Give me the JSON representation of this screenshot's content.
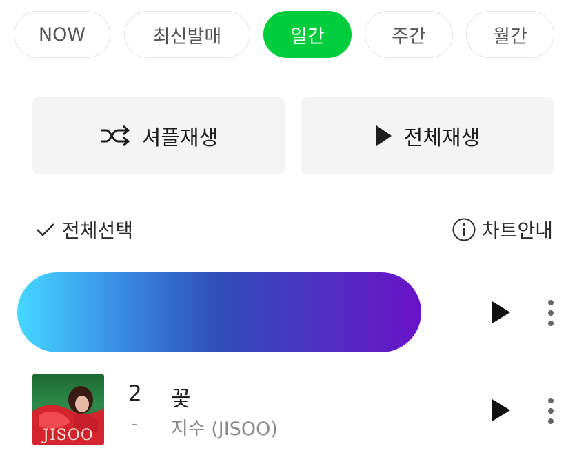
{
  "tabs": [
    {
      "label": "NOW",
      "active": false
    },
    {
      "label": "최신발매",
      "active": false
    },
    {
      "label": "일간",
      "active": true
    },
    {
      "label": "주간",
      "active": false
    },
    {
      "label": "월간",
      "active": false
    }
  ],
  "actions": {
    "shuffle_label": "셔플재생",
    "play_all_label": "전체재생"
  },
  "list_header": {
    "select_all_label": "전체선택",
    "chart_guide_label": "차트안내"
  },
  "songs": [
    {
      "rank": "2",
      "change": "-",
      "title": "꽃",
      "artist": "지수 (JISOO)",
      "album_art_text": "JISOO"
    }
  ],
  "colors": {
    "accent": "#00cd3c",
    "banner_gradient": [
      "#44d8ff",
      "#2f4db8",
      "#6a12c8"
    ]
  },
  "icons": {
    "shuffle": "shuffle-icon",
    "play": "play-icon",
    "check": "check-icon",
    "info": "info-icon",
    "more": "more-vertical-icon"
  }
}
